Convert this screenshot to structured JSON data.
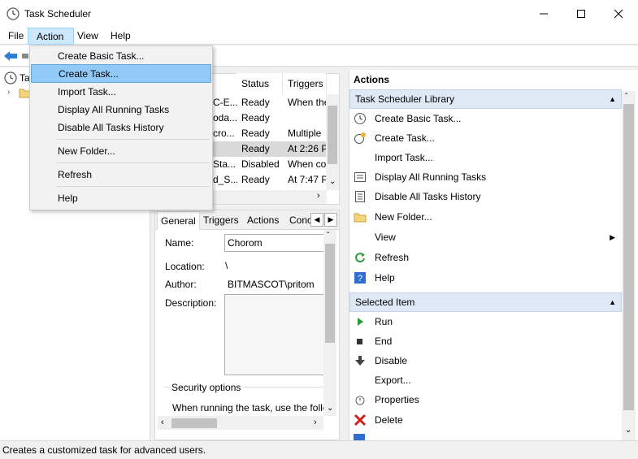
{
  "window": {
    "title": "Task Scheduler"
  },
  "menubar": {
    "file": "File",
    "action": "Action",
    "view": "View",
    "help": "Help"
  },
  "tree": {
    "root_label": "Ta",
    "child_label": ""
  },
  "tasklist": {
    "headers": [
      "Status",
      "Triggers"
    ],
    "rows": [
      {
        "name": "C-E...",
        "status": "Ready",
        "trigger": "When the"
      },
      {
        "name": "oda...",
        "status": "Ready",
        "trigger": ""
      },
      {
        "name": "cro...",
        "status": "Ready",
        "trigger": "Multiple"
      },
      {
        "name": "",
        "status": "Ready",
        "trigger": "At 2:26 P"
      },
      {
        "name": "Sta...",
        "status": "Disabled",
        "trigger": "When co"
      },
      {
        "name": "d_S...",
        "status": "Ready",
        "trigger": "At 7:47 P"
      }
    ]
  },
  "detail": {
    "tabs": [
      "General",
      "Triggers",
      "Actions",
      "Conc"
    ],
    "name_label": "Name:",
    "name_value": "Chorom",
    "location_label": "Location:",
    "location_value": "\\",
    "author_label": "Author:",
    "author_value": "BITMASCOT\\pritom",
    "description_label": "Description:",
    "security_label": "Security options",
    "security_text": "When running the task, use the follo"
  },
  "actions": {
    "title": "Actions",
    "section_library": "Task Scheduler Library",
    "library_items": [
      {
        "label": "Create Basic Task...",
        "icon": "clock-wizard-icon"
      },
      {
        "label": "Create Task...",
        "icon": "create-task-icon"
      },
      {
        "label": "Import Task...",
        "icon": ""
      },
      {
        "label": "Display All Running Tasks",
        "icon": "list-icon"
      },
      {
        "label": "Disable All Tasks History",
        "icon": "history-icon"
      },
      {
        "label": "New Folder...",
        "icon": "folder-icon"
      },
      {
        "label": "View",
        "icon": ""
      },
      {
        "label": "Refresh",
        "icon": "refresh-icon"
      },
      {
        "label": "Help",
        "icon": "help-icon"
      }
    ],
    "section_selected": "Selected Item",
    "selected_items": [
      {
        "label": "Run",
        "icon": "run-icon"
      },
      {
        "label": "End",
        "icon": "end-icon"
      },
      {
        "label": "Disable",
        "icon": "disable-icon"
      },
      {
        "label": "Export...",
        "icon": ""
      },
      {
        "label": "Properties",
        "icon": "properties-icon"
      },
      {
        "label": "Delete",
        "icon": "delete-icon"
      }
    ]
  },
  "dropdown": {
    "items": [
      "Create Basic Task...",
      "Create Task...",
      "Import Task...",
      "Display All Running Tasks",
      "Disable All Tasks History",
      "New Folder...",
      "Refresh",
      "Help"
    ],
    "highlighted": "Create Task..."
  },
  "statusbar": {
    "text": "Creates a customized task for advanced users."
  }
}
